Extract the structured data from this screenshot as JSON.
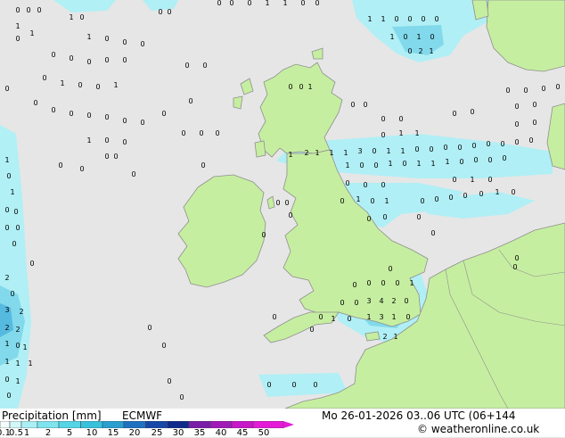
{
  "footer": {
    "title": "Precipitation [mm]",
    "model": "ECMWF",
    "valid_time": "Mo 26-01-2026 03..06 UTC (06+144",
    "credit": "weatheronline.co.uk",
    "credit_symbol": "©"
  },
  "legend": {
    "ticks": [
      "0.1",
      "0.5",
      "1",
      "2",
      "5",
      "10",
      "15",
      "20",
      "25",
      "30",
      "35",
      "40",
      "45",
      "50"
    ],
    "colors": [
      "#f4fdfd",
      "#d2f7f9",
      "#a9eff4",
      "#7ee4ee",
      "#55d5e6",
      "#38c1dc",
      "#2a9fd0",
      "#2072c0",
      "#1748a8",
      "#102a8c",
      "#7a1ea8",
      "#a01ab8",
      "#c818c8",
      "#e41ad8"
    ]
  },
  "colors": {
    "sea": "#e6e6e6",
    "land": "#c6eea0",
    "coast": "#8f8f8f",
    "light_precip": "#aef0f6",
    "moderate_precip": "#7cd9ec",
    "heavy_precip": "#4fb8e0"
  }
}
